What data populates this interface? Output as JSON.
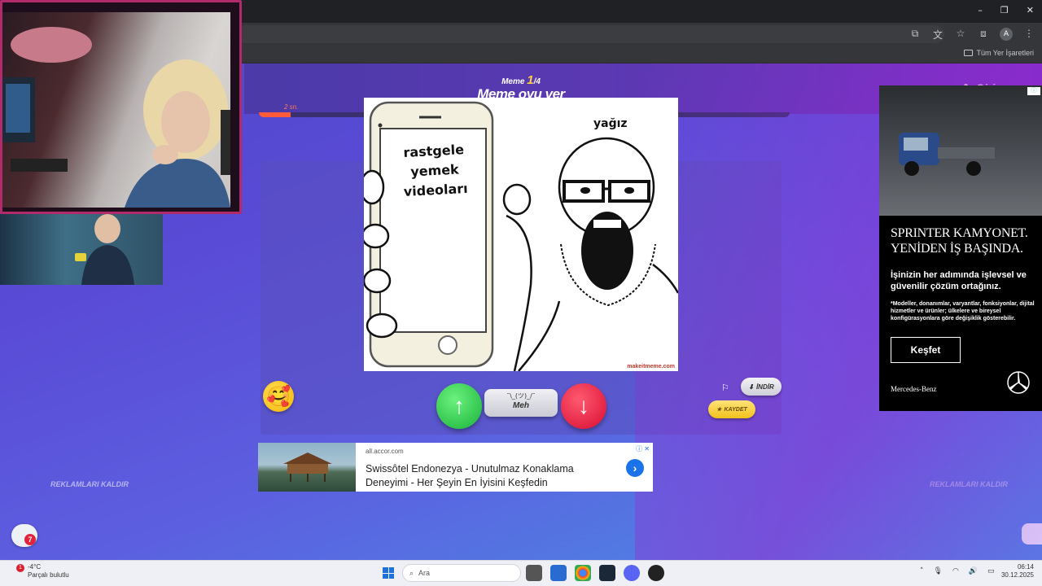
{
  "browser": {
    "window_controls": [
      "–",
      "❐",
      "✕"
    ],
    "profile_initial": "A",
    "bookmarks_all": "Tüm Yer İşaretleri"
  },
  "header": {
    "counter_prefix": "Meme",
    "counter_current": "1",
    "counter_total": "/4",
    "title": "Meme oyu ver",
    "login_label": "Giriş yap",
    "timer_label": "2 sn.",
    "timer_progress": 0.06
  },
  "meme": {
    "phone_text": "rastgele yemek videoları",
    "character_label": "yağız",
    "watermark": "makeitmeme.com"
  },
  "actions": {
    "emoji": "🥰",
    "upvote": "↑",
    "meh_face": "¯\\_(ツ)_/¯",
    "meh_label": "Meh",
    "downvote": "↓",
    "flag": "⚐",
    "download_label": "İNDİR",
    "save_label": "KAYDET",
    "remove_ads": "REKLAMLARI KALDIR"
  },
  "ad_right": {
    "headline": "SPRINTER KAMYONET. YENİDEN İŞ BAŞINDA.",
    "subtitle": "İşinizin her adımında işlevsel ve güvenilir çözüm ortağınız.",
    "fine_print": "*Modeller, donanımlar, varyantlar, fonksiyonlar, dijital hizmetler ve ürünler; ülkelere ve bireysel konfigürasyonlara göre değişiklik gösterebilir.",
    "cta": "Keşfet",
    "brand": "Mercedes-Benz"
  },
  "ad_bottom": {
    "domain": "all.accor.com",
    "title": "Swissôtel Endonezya - Unutulmaz Konaklama Deneyimi - Her Şeyin En İyisini Keşfedin"
  },
  "chat": {
    "badge": "7"
  },
  "taskbar": {
    "temperature": "-4°C",
    "weather": "Parçalı bulutlu",
    "weather_badge": "1",
    "search_placeholder": "Ara",
    "time": "06:14",
    "date": "30.12.2025"
  }
}
